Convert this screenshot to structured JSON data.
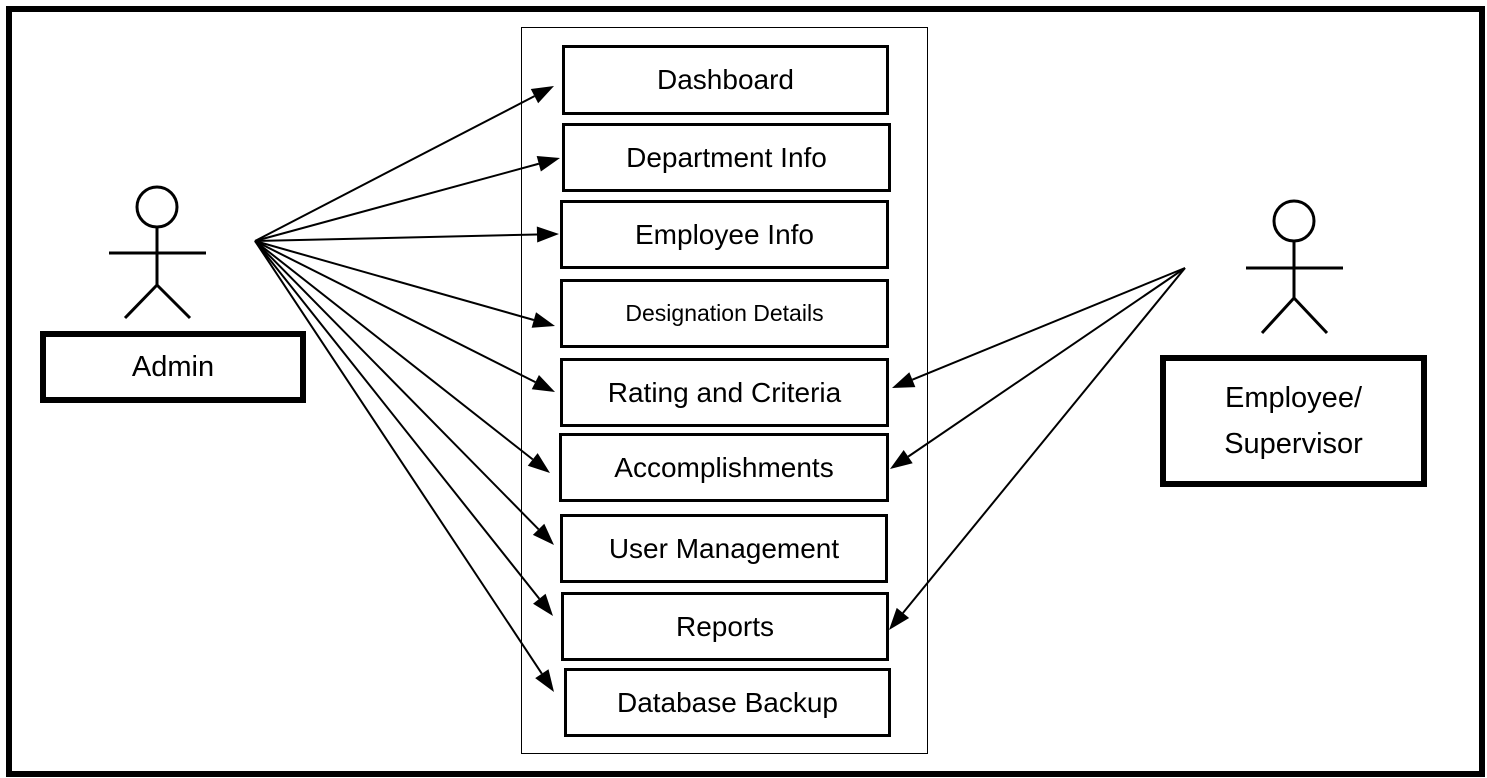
{
  "diagram": {
    "type": "use-case",
    "actors": [
      {
        "id": "admin",
        "label": "Admin"
      },
      {
        "id": "employee",
        "label_lines": [
          "Employee/",
          "Supervisor"
        ]
      }
    ],
    "use_cases": [
      {
        "id": "dashboard",
        "label": "Dashboard"
      },
      {
        "id": "department",
        "label": "Department Info"
      },
      {
        "id": "employee_info",
        "label": "Employee Info"
      },
      {
        "id": "designation",
        "label": "Designation Details"
      },
      {
        "id": "rating",
        "label": "Rating and Criteria"
      },
      {
        "id": "accomplishments",
        "label": "Accomplishments"
      },
      {
        "id": "user_mgmt",
        "label": "User Management"
      },
      {
        "id": "reports",
        "label": "Reports"
      },
      {
        "id": "backup",
        "label": "Database Backup"
      }
    ],
    "associations": [
      {
        "from": "admin",
        "to": "dashboard"
      },
      {
        "from": "admin",
        "to": "department"
      },
      {
        "from": "admin",
        "to": "employee_info"
      },
      {
        "from": "admin",
        "to": "designation"
      },
      {
        "from": "admin",
        "to": "rating"
      },
      {
        "from": "admin",
        "to": "accomplishments"
      },
      {
        "from": "admin",
        "to": "user_mgmt"
      },
      {
        "from": "admin",
        "to": "reports"
      },
      {
        "from": "admin",
        "to": "backup"
      },
      {
        "from": "employee",
        "to": "rating"
      },
      {
        "from": "employee",
        "to": "accomplishments"
      },
      {
        "from": "employee",
        "to": "reports"
      }
    ]
  }
}
